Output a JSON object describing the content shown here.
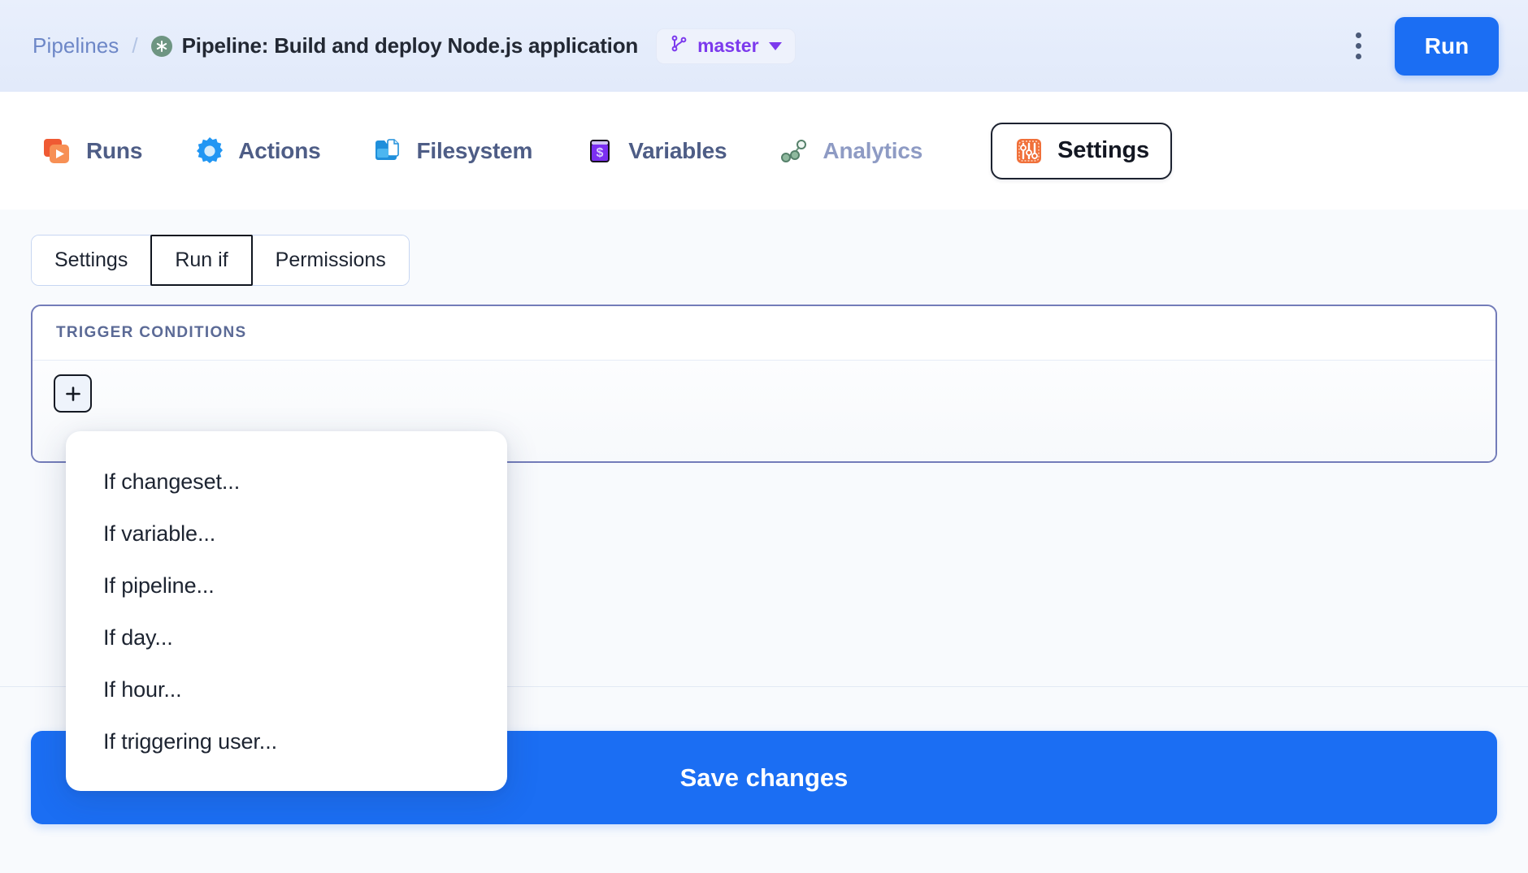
{
  "header": {
    "breadcrumb_root": "Pipelines",
    "breadcrumb_separator": "/",
    "pipeline_icon": "pipeline-asterisk-icon",
    "title": "Pipeline: Build and deploy Node.js application",
    "branch": {
      "icon": "git-branch-icon",
      "name": "master",
      "caret_icon": "chevron-down-icon"
    },
    "more_menu_icon": "kebab-menu-icon",
    "run_label": "Run",
    "accent_blue": "#1b6ef3",
    "branch_purple": "#7c3aed",
    "band_background": "#e6edfb"
  },
  "nav": {
    "tabs": [
      {
        "label": "Runs",
        "icon": "runs-play-icon",
        "active": false,
        "muted": false
      },
      {
        "label": "Actions",
        "icon": "actions-gear-icon",
        "active": false,
        "muted": false
      },
      {
        "label": "Filesystem",
        "icon": "filesystem-folder-icon",
        "active": false,
        "muted": false
      },
      {
        "label": "Variables",
        "icon": "variables-terminal-icon",
        "active": false,
        "muted": false
      },
      {
        "label": "Analytics",
        "icon": "analytics-graph-icon",
        "active": false,
        "muted": true
      },
      {
        "label": "Settings",
        "icon": "settings-sliders-icon",
        "active": true,
        "muted": false
      }
    ]
  },
  "subtabs": {
    "items": [
      {
        "label": "Settings",
        "active": false
      },
      {
        "label": "Run if",
        "active": true
      },
      {
        "label": "Permissions",
        "active": false
      }
    ]
  },
  "card": {
    "title": "TRIGGER CONDITIONS",
    "add_icon": "plus-icon",
    "border_color": "#737cb9"
  },
  "dropdown": {
    "items": [
      {
        "label": "If changeset..."
      },
      {
        "label": "If variable..."
      },
      {
        "label": "If pipeline..."
      },
      {
        "label": "If day..."
      },
      {
        "label": "If hour..."
      },
      {
        "label": "If triggering user..."
      }
    ]
  },
  "footer": {
    "save_label": "Save changes"
  }
}
